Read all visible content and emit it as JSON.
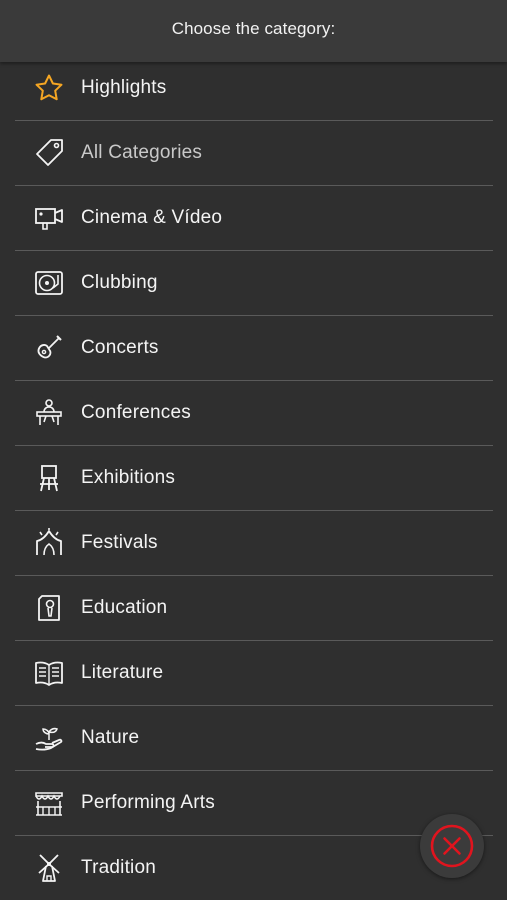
{
  "header": {
    "title": "Choose the category:"
  },
  "categories": [
    {
      "label": "Highlights",
      "icon": "star-icon",
      "accent": "#f5a623"
    },
    {
      "label": "All Categories",
      "icon": "tag-icon"
    },
    {
      "label": "Cinema & Vídeo",
      "icon": "video-camera-icon"
    },
    {
      "label": "Clubbing",
      "icon": "turntable-icon"
    },
    {
      "label": "Concerts",
      "icon": "guitar-icon"
    },
    {
      "label": "Conferences",
      "icon": "conference-speaker-icon"
    },
    {
      "label": "Exhibitions",
      "icon": "easel-icon"
    },
    {
      "label": "Festivals",
      "icon": "festival-tent-icon"
    },
    {
      "label": "Education",
      "icon": "education-icon"
    },
    {
      "label": "Literature",
      "icon": "book-icon"
    },
    {
      "label": "Nature",
      "icon": "plant-hand-icon"
    },
    {
      "label": "Performing Arts",
      "icon": "theater-stage-icon"
    },
    {
      "label": "Tradition",
      "icon": "windmill-icon"
    }
  ],
  "close_button": {
    "icon": "close-circle-icon",
    "color": "#e0141e"
  },
  "colors": {
    "background": "#2f2f2f",
    "header": "#3a3a3a",
    "divider": "#5a5a5a",
    "text": "#f4f4f4"
  }
}
